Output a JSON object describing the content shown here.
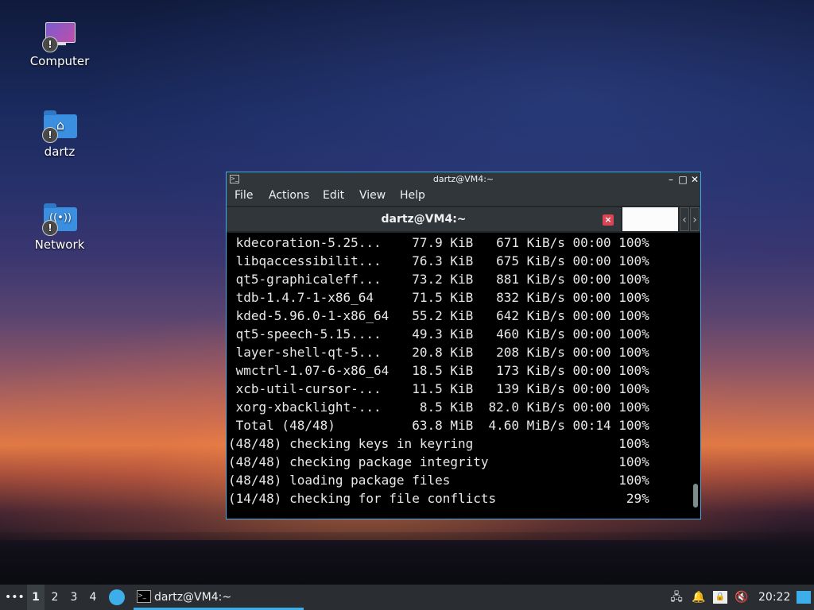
{
  "desktop": {
    "icons": [
      {
        "label": "Computer",
        "icon": "computer-icon"
      },
      {
        "label": "dartz",
        "icon": "home-folder-icon"
      },
      {
        "label": "Network",
        "icon": "network-folder-icon"
      }
    ],
    "warning_glyph": "!"
  },
  "window": {
    "title": "dartz@VM4:~",
    "controls": {
      "minimize": "–",
      "maximize": "□",
      "close": "✕"
    },
    "menu": [
      "File",
      "Actions",
      "Edit",
      "View",
      "Help"
    ],
    "tab": {
      "label": "dartz@VM4:~",
      "close": "×",
      "prev": "‹",
      "next": "›"
    },
    "terminal_lines": [
      " kdecoration-5.25...    77.9 KiB   671 KiB/s 00:00 100%",
      " libqaccessibilit...    76.3 KiB   675 KiB/s 00:00 100%",
      " qt5-graphicaleff...    73.2 KiB   881 KiB/s 00:00 100%",
      " tdb-1.4.7-1-x86_64     71.5 KiB   832 KiB/s 00:00 100%",
      " kded-5.96.0-1-x86_64   55.2 KiB   642 KiB/s 00:00 100%",
      " qt5-speech-5.15....    49.3 KiB   460 KiB/s 00:00 100%",
      " layer-shell-qt-5...    20.8 KiB   208 KiB/s 00:00 100%",
      " wmctrl-1.07-6-x86_64   18.5 KiB   173 KiB/s 00:00 100%",
      " xcb-util-cursor-...    11.5 KiB   139 KiB/s 00:00 100%",
      " xorg-xbacklight-...     8.5 KiB  82.0 KiB/s 00:00 100%",
      " Total (48/48)          63.8 MiB  4.60 MiB/s 00:14 100%",
      "(48/48) checking keys in keyring                   100%",
      "(48/48) checking package integrity                 100%",
      "(48/48) loading package files                      100%",
      "(14/48) checking for file conflicts                 29%"
    ]
  },
  "taskbar": {
    "overflow": "•••",
    "desktops": [
      "1",
      "2",
      "3",
      "4"
    ],
    "active_desktop": "1",
    "task_label": "dartz@VM4:~",
    "clock": "20:22"
  },
  "colors": {
    "accent": "#3daee9",
    "panel": "#2a2e32",
    "window_chrome": "#31363b"
  }
}
